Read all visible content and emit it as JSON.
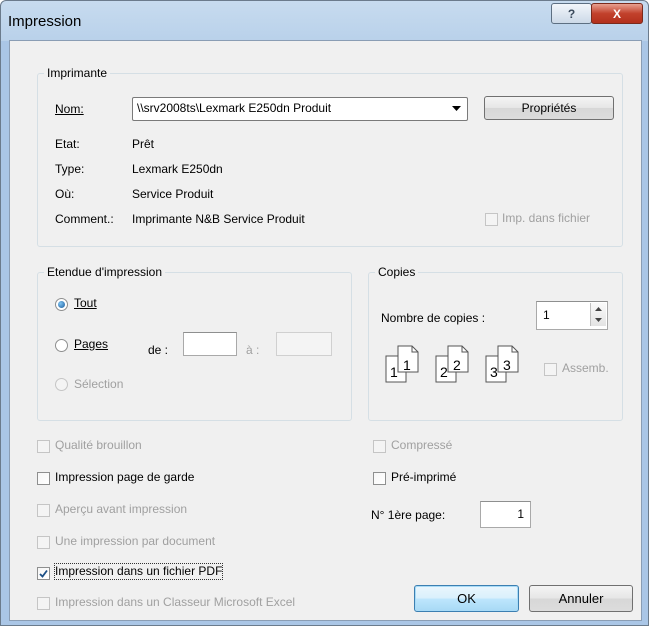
{
  "window": {
    "title": "Impression"
  },
  "printer": {
    "group_title": "Imprimante",
    "name_label": "Nom:",
    "name_value": "\\\\srv2008ts\\Lexmark E250dn Produit",
    "properties_button": "Propriétés",
    "status_label": "Etat:",
    "status_value": "Prêt",
    "type_label": "Type:",
    "type_value": "Lexmark E250dn",
    "where_label": "Où:",
    "where_value": "Service Produit",
    "comment_label": "Comment.:",
    "comment_value": "Imprimante N&B Service Produit",
    "print_to_file_label": "Imp. dans fichier",
    "print_to_file_checked": false
  },
  "range": {
    "group_title": "Etendue d'impression",
    "all_label": "Tout",
    "pages_label": "Pages",
    "from_label": "de :",
    "to_label": "à :",
    "from_value": "",
    "to_value": "",
    "selection_label": "Sélection",
    "selected": "Tout"
  },
  "copies": {
    "group_title": "Copies",
    "count_label": "Nombre de copies :",
    "count_value": "1",
    "collate_label": "Assemb.",
    "collate_checked": false,
    "collate_pages": [
      "1",
      "1",
      "2",
      "2",
      "3",
      "3"
    ]
  },
  "options": {
    "draft_quality": {
      "label": "Qualité brouillon",
      "checked": false,
      "enabled": false
    },
    "cover_page": {
      "label": "Impression page de garde",
      "checked": false,
      "enabled": true
    },
    "preview": {
      "label": "Aperçu avant impression",
      "checked": false,
      "enabled": false
    },
    "one_per_document": {
      "label": "Une impression par document",
      "checked": false,
      "enabled": false
    },
    "pdf_file": {
      "label": "Impression dans un fichier PDF",
      "checked": true,
      "enabled": true
    },
    "excel": {
      "label": "Impression dans un Classeur Microsoft Excel",
      "checked": false,
      "enabled": false
    },
    "compressed": {
      "label": "Compressé",
      "checked": false,
      "enabled": false
    },
    "preprinted": {
      "label": "Pré-imprimé",
      "checked": false,
      "enabled": true
    },
    "first_page_label": "N° 1ère page:",
    "first_page_value": "1"
  },
  "buttons": {
    "ok": "OK",
    "cancel": "Annuler",
    "help": "?",
    "close": "X"
  },
  "colors": {
    "title_bar": "#b9d1ea",
    "close_button": "#c2412c",
    "dialog_bg": "#f0f0f0"
  }
}
